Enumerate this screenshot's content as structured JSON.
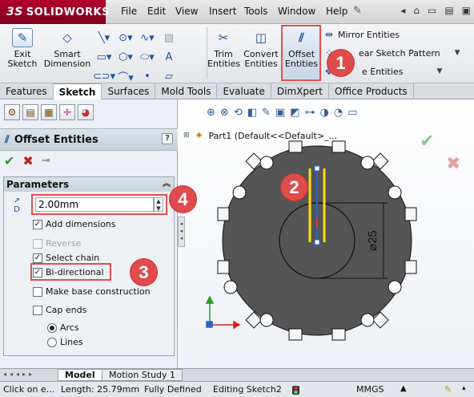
{
  "app": {
    "logo_text": "SOLIDWORKS",
    "menu": [
      "File",
      "Edit",
      "View",
      "Insert",
      "Tools",
      "Window",
      "Help"
    ]
  },
  "ribbon": {
    "exit_sketch": "Exit Sketch",
    "smart_dimension": "Smart Dimension",
    "trim_entities": "Trim Entities",
    "convert_entities": "Convert Entities",
    "offset_entities": "Offset Entities",
    "mirror_entities": "Mirror Entities",
    "linear_sketch_pattern": "ear Sketch Pattern",
    "move_entities": "e Entities"
  },
  "tabs": [
    "Features",
    "Sketch",
    "Surfaces",
    "Mold Tools",
    "Evaluate",
    "DimXpert",
    "Office Products"
  ],
  "active_tab": "Sketch",
  "property_manager": {
    "title": "Offset Entities",
    "help": "?",
    "group_title": "Parameters",
    "distance_value": "2.00mm",
    "options": [
      {
        "label": "Add dimensions",
        "checked": true,
        "disabled": false
      },
      {
        "label": "Reverse",
        "checked": false,
        "disabled": true
      },
      {
        "label": "Select chain",
        "checked": true,
        "disabled": false
      },
      {
        "label": "Bi-directional",
        "checked": true,
        "disabled": false
      },
      {
        "label": "Make base construction",
        "checked": false,
        "disabled": false
      },
      {
        "label": "Cap ends",
        "checked": false,
        "disabled": false
      }
    ],
    "cap_types": [
      {
        "label": "Arcs",
        "selected": true
      },
      {
        "label": "Lines",
        "selected": false
      }
    ]
  },
  "feature_tree": {
    "part_label": "Part1  (Default<<Default>_..."
  },
  "drawing": {
    "dimension_label": "⌀25",
    "colors": {
      "plate": "#555555",
      "hole": "#ffffff",
      "offset": "#ffe000",
      "selected": "#2468d8",
      "sketch_line": "#111111"
    }
  },
  "bottom_tabs": [
    "Model",
    "Motion Study 1"
  ],
  "status_bar": {
    "hint": "Click on e...",
    "length": "Length: 25.79mm",
    "definition": "Fully Defined",
    "editing": "Editing Sketch2",
    "units": "MMGS"
  },
  "callouts": [
    "1",
    "2",
    "3",
    "4"
  ]
}
